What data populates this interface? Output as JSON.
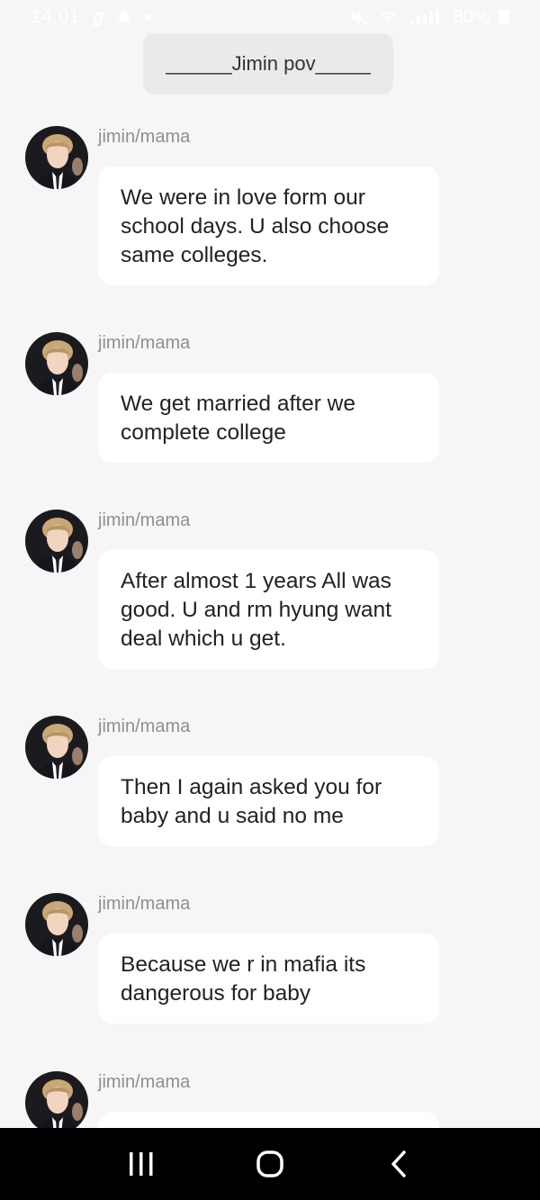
{
  "status_bar": {
    "time": "14:01",
    "app_glyph": "g",
    "battery": "80%",
    "icons": [
      "snapchat-icon",
      "mute-icon",
      "wifi-icon",
      "signal-icon",
      "battery-icon"
    ]
  },
  "chapter": {
    "title": "______Jimin pov_____"
  },
  "messages": [
    {
      "sender": "jimin/mama",
      "text": "We were in love form our school days. U also choose same colleges."
    },
    {
      "sender": "jimin/mama",
      "text": "We get married after we complete college"
    },
    {
      "sender": "jimin/mama",
      "text": "After  almost 1 years All was good. U and rm hyung want deal which u get."
    },
    {
      "sender": "jimin/mama",
      "text": "Then I again asked you for baby and u said no me"
    },
    {
      "sender": "jimin/mama",
      "text": "Because we r in mafia its dangerous for baby"
    },
    {
      "sender": "jimin/mama",
      "text": ""
    }
  ],
  "nav": {
    "icons": [
      "recent-apps-icon",
      "home-icon",
      "back-icon"
    ]
  },
  "colors": {
    "background": "#f6f6f6",
    "bubble": "#ffffff",
    "sender": "#8f8f8f",
    "nav_bar": "#000000"
  }
}
